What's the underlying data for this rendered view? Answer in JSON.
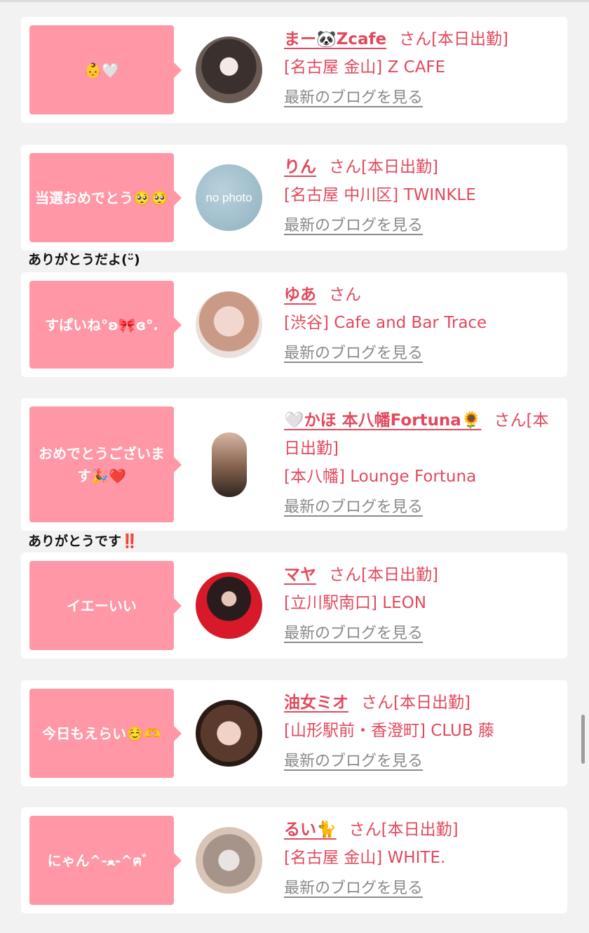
{
  "entries": [
    {
      "message": "👶🤍",
      "name": "まー🐼Zcafe",
      "honorific": "さん",
      "status": "[本日出勤]",
      "shop": "[名古屋 金山] Z CAFE",
      "blog_link": "最新のブログを見る",
      "avatar": "photo-dark-hair"
    },
    {
      "message": "当選おめでとう🥺🥺",
      "name": "りん",
      "honorific": "さん",
      "status": "[本日出勤]",
      "shop": "[名古屋 中川区] TWINKLE",
      "blog_link": "最新のブログを見る",
      "avatar": "no-photo",
      "avatar_text": "no photo",
      "reply": "ありがとうだよ(ᵕ̈)"
    },
    {
      "message": "すぱいね°ʚ🎀ɞ°.",
      "name": "ゆあ",
      "honorific": "さん",
      "status": "",
      "shop": "[渋谷] Cafe and Bar Trace",
      "blog_link": "最新のブログを見る",
      "avatar": "photo-light"
    },
    {
      "message": "おめでとうございます🎉❤️",
      "name": "🤍かほ 本八幡Fortuna🌻",
      "honorific": "さん",
      "status": "[本日出勤]",
      "shop": "[本八幡] Lounge Fortuna",
      "blog_link": "最新のブログを見る",
      "avatar": "photo-tall",
      "reply": "ありがとうです‼️"
    },
    {
      "message": "イエーいい",
      "name": "マヤ",
      "honorific": "さん",
      "status": "[本日出勤]",
      "shop": "[立川駅南口] LEON",
      "blog_link": "最新のブログを見る",
      "avatar": "photo-red"
    },
    {
      "message": "今日もえらい☺️🫶",
      "name": "油女ミオ",
      "honorific": "さん",
      "status": "[本日出勤]",
      "shop": "[山形駅前・香澄町] CLUB 藤",
      "blog_link": "最新のブログを見る",
      "avatar": "photo-dog-filter"
    },
    {
      "message": "にゃん^-ﻌ-^ฅ゛",
      "name": "るい🐈",
      "honorific": "さん",
      "status": "[本日出勤]",
      "shop": "[名古屋 金山] WHITE.",
      "blog_link": "最新のブログを見る",
      "avatar": "photo-mask"
    }
  ],
  "colors": {
    "page_background": "#f2f2f2",
    "bubble": "#ff97a6",
    "name_text": "#e2495c",
    "blog_link": "#8a8a8a"
  }
}
